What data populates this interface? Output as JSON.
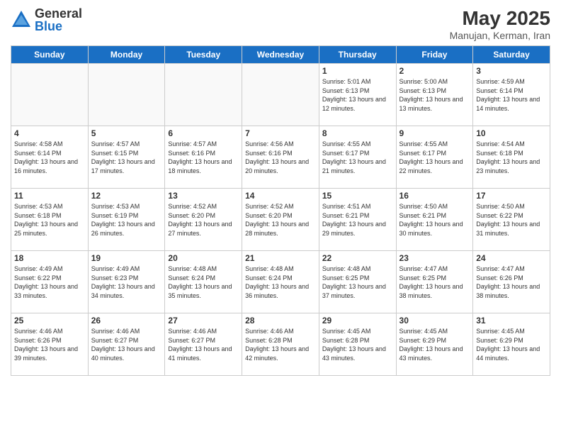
{
  "logo": {
    "general": "General",
    "blue": "Blue"
  },
  "title": "May 2025",
  "location": "Manujan, Kerman, Iran",
  "weekdays": [
    "Sunday",
    "Monday",
    "Tuesday",
    "Wednesday",
    "Thursday",
    "Friday",
    "Saturday"
  ],
  "weeks": [
    [
      {
        "day": "",
        "info": ""
      },
      {
        "day": "",
        "info": ""
      },
      {
        "day": "",
        "info": ""
      },
      {
        "day": "",
        "info": ""
      },
      {
        "day": "1",
        "info": "Sunrise: 5:01 AM\nSunset: 6:13 PM\nDaylight: 13 hours\nand 12 minutes."
      },
      {
        "day": "2",
        "info": "Sunrise: 5:00 AM\nSunset: 6:13 PM\nDaylight: 13 hours\nand 13 minutes."
      },
      {
        "day": "3",
        "info": "Sunrise: 4:59 AM\nSunset: 6:14 PM\nDaylight: 13 hours\nand 14 minutes."
      }
    ],
    [
      {
        "day": "4",
        "info": "Sunrise: 4:58 AM\nSunset: 6:14 PM\nDaylight: 13 hours\nand 16 minutes."
      },
      {
        "day": "5",
        "info": "Sunrise: 4:57 AM\nSunset: 6:15 PM\nDaylight: 13 hours\nand 17 minutes."
      },
      {
        "day": "6",
        "info": "Sunrise: 4:57 AM\nSunset: 6:16 PM\nDaylight: 13 hours\nand 18 minutes."
      },
      {
        "day": "7",
        "info": "Sunrise: 4:56 AM\nSunset: 6:16 PM\nDaylight: 13 hours\nand 20 minutes."
      },
      {
        "day": "8",
        "info": "Sunrise: 4:55 AM\nSunset: 6:17 PM\nDaylight: 13 hours\nand 21 minutes."
      },
      {
        "day": "9",
        "info": "Sunrise: 4:55 AM\nSunset: 6:17 PM\nDaylight: 13 hours\nand 22 minutes."
      },
      {
        "day": "10",
        "info": "Sunrise: 4:54 AM\nSunset: 6:18 PM\nDaylight: 13 hours\nand 23 minutes."
      }
    ],
    [
      {
        "day": "11",
        "info": "Sunrise: 4:53 AM\nSunset: 6:18 PM\nDaylight: 13 hours\nand 25 minutes."
      },
      {
        "day": "12",
        "info": "Sunrise: 4:53 AM\nSunset: 6:19 PM\nDaylight: 13 hours\nand 26 minutes."
      },
      {
        "day": "13",
        "info": "Sunrise: 4:52 AM\nSunset: 6:20 PM\nDaylight: 13 hours\nand 27 minutes."
      },
      {
        "day": "14",
        "info": "Sunrise: 4:52 AM\nSunset: 6:20 PM\nDaylight: 13 hours\nand 28 minutes."
      },
      {
        "day": "15",
        "info": "Sunrise: 4:51 AM\nSunset: 6:21 PM\nDaylight: 13 hours\nand 29 minutes."
      },
      {
        "day": "16",
        "info": "Sunrise: 4:50 AM\nSunset: 6:21 PM\nDaylight: 13 hours\nand 30 minutes."
      },
      {
        "day": "17",
        "info": "Sunrise: 4:50 AM\nSunset: 6:22 PM\nDaylight: 13 hours\nand 31 minutes."
      }
    ],
    [
      {
        "day": "18",
        "info": "Sunrise: 4:49 AM\nSunset: 6:22 PM\nDaylight: 13 hours\nand 33 minutes."
      },
      {
        "day": "19",
        "info": "Sunrise: 4:49 AM\nSunset: 6:23 PM\nDaylight: 13 hours\nand 34 minutes."
      },
      {
        "day": "20",
        "info": "Sunrise: 4:48 AM\nSunset: 6:24 PM\nDaylight: 13 hours\nand 35 minutes."
      },
      {
        "day": "21",
        "info": "Sunrise: 4:48 AM\nSunset: 6:24 PM\nDaylight: 13 hours\nand 36 minutes."
      },
      {
        "day": "22",
        "info": "Sunrise: 4:48 AM\nSunset: 6:25 PM\nDaylight: 13 hours\nand 37 minutes."
      },
      {
        "day": "23",
        "info": "Sunrise: 4:47 AM\nSunset: 6:25 PM\nDaylight: 13 hours\nand 38 minutes."
      },
      {
        "day": "24",
        "info": "Sunrise: 4:47 AM\nSunset: 6:26 PM\nDaylight: 13 hours\nand 38 minutes."
      }
    ],
    [
      {
        "day": "25",
        "info": "Sunrise: 4:46 AM\nSunset: 6:26 PM\nDaylight: 13 hours\nand 39 minutes."
      },
      {
        "day": "26",
        "info": "Sunrise: 4:46 AM\nSunset: 6:27 PM\nDaylight: 13 hours\nand 40 minutes."
      },
      {
        "day": "27",
        "info": "Sunrise: 4:46 AM\nSunset: 6:27 PM\nDaylight: 13 hours\nand 41 minutes."
      },
      {
        "day": "28",
        "info": "Sunrise: 4:46 AM\nSunset: 6:28 PM\nDaylight: 13 hours\nand 42 minutes."
      },
      {
        "day": "29",
        "info": "Sunrise: 4:45 AM\nSunset: 6:28 PM\nDaylight: 13 hours\nand 43 minutes."
      },
      {
        "day": "30",
        "info": "Sunrise: 4:45 AM\nSunset: 6:29 PM\nDaylight: 13 hours\nand 43 minutes."
      },
      {
        "day": "31",
        "info": "Sunrise: 4:45 AM\nSunset: 6:29 PM\nDaylight: 13 hours\nand 44 minutes."
      }
    ]
  ]
}
